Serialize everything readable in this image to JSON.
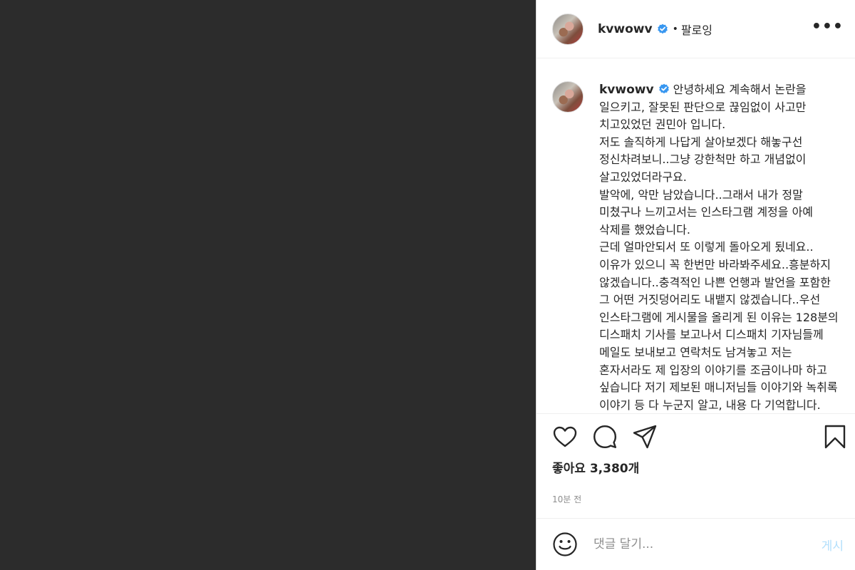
{
  "header": {
    "username": "kvwowv",
    "separator": "•",
    "follow_label": "팔로잉",
    "more_label": "•••"
  },
  "caption": {
    "username": "kvwowv",
    "text": " 안녕하세요 계속해서 논란을 일으키고, 잘못된 판단으로 끊임없이 사고만 치고있었던 권민아 입니다.\n저도 솔직하게 나답게 살아보겠다 해놓구선 정신차려보니..그냥 강한척만 하고 개념없이 살고있었더라구요.\n발악에, 악만 남았습니다..그래서 내가 정말 미쳤구나 느끼고서는 인스타그램 계정을 아예 삭제를 했었습니다.\n근데 얼마안되서 또 이렇게 돌아오게 됬네요..이유가 있으니 꼭 한번만 바라봐주세요..흥분하지 않겠습니다..충격적인 나쁜 언행과 발언을 포함한 그 어떤 거짓덩어리도 내뱉지 않겠습니다..우선 인스타그램에 게시물을 올리게 된 이유는 128분의 디스패치 기사를 보고나서 디스패치 기자님들께 메일도 보내보고 연락처도 남겨놓고 저는 혼자서라도 제 입장의 이야기를 조금이나마 하고 싶습니다 저기 제보된 매니저님들 이야기와 녹취록 이야기 등 다 누군지 알고, 내용 다 기억합니다. 하지만 그 녹취록을 제"
  },
  "likes": {
    "text": "좋아요 3,380개"
  },
  "timestamp": "10분 전",
  "comment_box": {
    "placeholder": "댓글 달기...",
    "post_label": "게시"
  },
  "colors": {
    "verified": "#3897f0",
    "post_button_disabled": "#b2dffc",
    "media_background": "#2c2c2c"
  },
  "icons": [
    "verified-badge-icon",
    "heart-icon",
    "comment-icon",
    "share-icon",
    "bookmark-icon",
    "smiley-icon",
    "more-options-icon"
  ]
}
